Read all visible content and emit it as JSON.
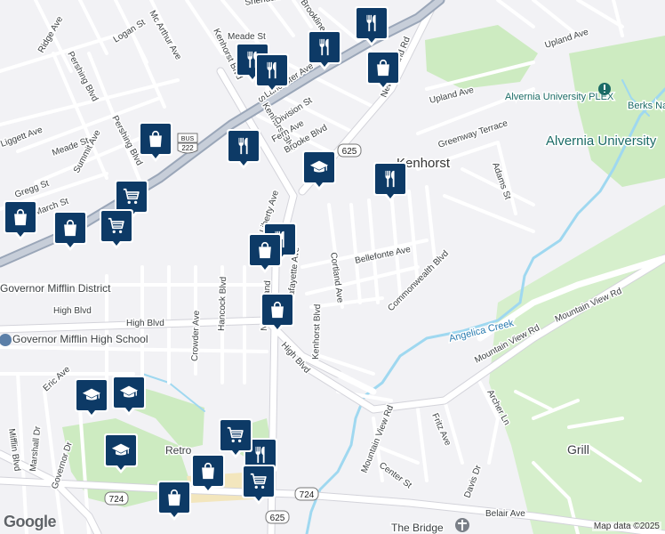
{
  "map": {
    "colors": {
      "background": "#f2f2f5",
      "road": "#ffffff",
      "highway": "#9aa6b8",
      "park": "#cdebc1",
      "water": "#9fd8f0",
      "marker": "#0d3a66",
      "university_label": "#1b6b66"
    },
    "labels": {
      "kenhorst": "Kenhorst",
      "alvernia_university": "Alvernia University",
      "alvernia_plex": "Alvernia University PLEX",
      "berks_angel": "Berks Nature Angelica Creek",
      "governor_mifflin_district": "Governor Mifflin District",
      "governor_mifflin_high": "Governor Mifflin High School",
      "retro": "Retro",
      "grill": "Grill",
      "the_bridge": "The Bridge",
      "angelica_creek": "Angelica Creek"
    },
    "streets": {
      "meade_st_1": "Meade St",
      "meade_st_2": "Meade St",
      "logan_st": "Logan St",
      "mcarthur_ave": "Mc Arthur Ave",
      "ridge_ave": "Ridge Ave",
      "pershing_blvd_1": "Pershing Blvd",
      "pershing_blvd_2": "Pershing Blvd",
      "liggett_ave": "Liggett Ave",
      "summit_ave": "Summit Ave",
      "gregg_st": "Gregg St",
      "march_st": "March St",
      "lancaster_ave": "Lancaster Ave",
      "kenhorst_blvd_1": "Kenhorst Blvd",
      "kenhorst_blvd_2": "S Kenhorst Blvd",
      "kenhorst_blvd_3": "Kenhorst Blvd",
      "division_st": "Division St",
      "fern_ave": "Fern Ave",
      "brooke_blvd": "Brooke Blvd",
      "sheridan_st": "Sheridan St",
      "brookline": "Brookline",
      "new_holland_rd_1": "New Holland Rd",
      "new_holland_rd_2": "New Holland",
      "liberty_ave": "Liberty Ave",
      "lafayette_ave": "Lafayette Ave",
      "cortland_ave": "Cortland Ave",
      "bellefonte_ave": "Bellefonte Ave",
      "commonwealth_blvd": "Commonwealth Blvd",
      "upland_ave_1": "Upland Ave",
      "upland_ave_2": "Upland Ave",
      "greenway_terrace": "Greenway Terrace",
      "adams_st": "Adams St",
      "high_blvd_1": "High Blvd",
      "high_blvd_2": "High Blvd",
      "high_blvd_3": "High Blvd",
      "crowder_ave": "Crowder Ave",
      "hancock_blvd": "Hancock Blvd",
      "eric_ave": "Eric Ave",
      "mifflin_blvd": "Mifflin Blvd",
      "marshall_dr": "Marshall Dr",
      "governor_dr": "Governor Dr",
      "mountain_view_rd_1": "Mountain View Rd",
      "mountain_view_rd_2": "Mountain View Rd",
      "mountain_view_rd_3": "Mountain View Rd",
      "archer_ln": "Archer Ln",
      "fritz_ave": "Fritz Ave",
      "center_st": "Center St",
      "davis_dr": "Davis Dr",
      "belair_ave": "Belair Ave",
      "route_625_a": "625",
      "route_625_b": "625",
      "route_724_a": "724",
      "route_724_b": "724",
      "bus_222_top": "BUS",
      "bus_222_num": "222"
    },
    "attribution": "Map data ©2025",
    "logo": "Google",
    "markers": [
      {
        "type": "restaurant",
        "icon": "fork-knife-icon"
      },
      {
        "type": "restaurant",
        "icon": "fork-knife-icon"
      },
      {
        "type": "restaurant",
        "icon": "fork-knife-icon"
      },
      {
        "type": "restaurant",
        "icon": "fork-knife-icon"
      },
      {
        "type": "restaurant",
        "icon": "fork-knife-icon"
      },
      {
        "type": "restaurant",
        "icon": "fork-knife-icon"
      },
      {
        "type": "restaurant",
        "icon": "fork-knife-icon"
      },
      {
        "type": "restaurant",
        "icon": "fork-knife-icon"
      },
      {
        "type": "shopping",
        "icon": "shopping-bag-icon"
      },
      {
        "type": "shopping",
        "icon": "shopping-bag-icon"
      },
      {
        "type": "shopping",
        "icon": "shopping-bag-icon"
      },
      {
        "type": "shopping",
        "icon": "shopping-bag-icon"
      },
      {
        "type": "shopping",
        "icon": "shopping-bag-icon"
      },
      {
        "type": "shopping",
        "icon": "shopping-bag-icon"
      },
      {
        "type": "shopping",
        "icon": "shopping-bag-icon"
      },
      {
        "type": "shopping",
        "icon": "shopping-bag-icon"
      },
      {
        "type": "grocery",
        "icon": "shopping-cart-icon"
      },
      {
        "type": "grocery",
        "icon": "shopping-cart-icon"
      },
      {
        "type": "grocery",
        "icon": "shopping-cart-icon"
      },
      {
        "type": "grocery",
        "icon": "shopping-cart-icon"
      },
      {
        "type": "school",
        "icon": "graduation-cap-icon"
      },
      {
        "type": "school",
        "icon": "graduation-cap-icon"
      },
      {
        "type": "school",
        "icon": "graduation-cap-icon"
      },
      {
        "type": "school",
        "icon": "graduation-cap-icon"
      }
    ]
  }
}
